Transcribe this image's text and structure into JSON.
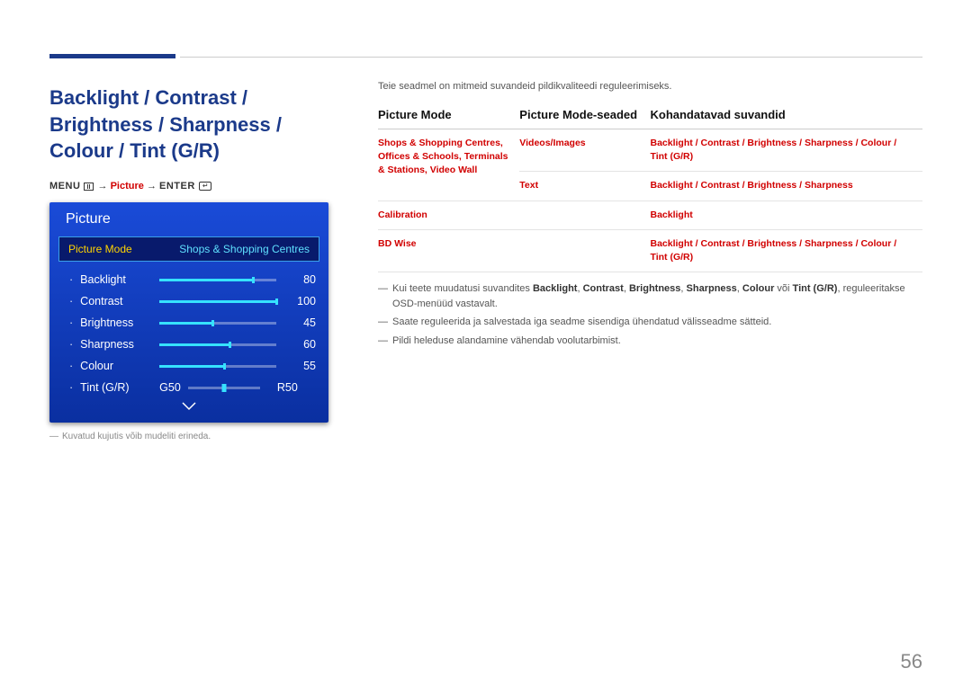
{
  "title": "Backlight / Contrast / Brightness / Sharpness / Colour / Tint (G/R)",
  "menupath": {
    "menu": "MENU",
    "picture": "Picture",
    "enter": "ENTER",
    "arrow": "→"
  },
  "osd": {
    "header": "Picture",
    "selected_label": "Picture Mode",
    "selected_value": "Shops & Shopping Centres",
    "rows": [
      {
        "label": "Backlight",
        "value": 80,
        "pct": 80
      },
      {
        "label": "Contrast",
        "value": 100,
        "pct": 100
      },
      {
        "label": "Brightness",
        "value": 45,
        "pct": 45
      },
      {
        "label": "Sharpness",
        "value": 60,
        "pct": 60
      },
      {
        "label": "Colour",
        "value": 55,
        "pct": 55
      }
    ],
    "tint": {
      "label": "Tint (G/R)",
      "g": "G50",
      "r": "R50"
    }
  },
  "footnote_small": "Kuvatud kujutis võib mudeliti erineda.",
  "intro": "Teie seadmel on mitmeid suvandeid pildikvaliteedi reguleerimiseks.",
  "table": {
    "headers": [
      "Picture Mode",
      "Picture Mode-seaded",
      "Kohandatavad suvandid"
    ],
    "rows": [
      {
        "c1": "Shops & Shopping Centres, Offices & Schools, Terminals & Stations, Video Wall",
        "c2": "Videos/Images",
        "c3": "Backlight / Contrast / Brightness / Sharpness / Colour / Tint (G/R)"
      },
      {
        "c1": "",
        "c2": "Text",
        "c3": "Backlight / Contrast / Brightness / Sharpness"
      },
      {
        "c1": "Calibration",
        "c2": "",
        "c3": "Backlight"
      },
      {
        "c1": "BD Wise",
        "c2": "",
        "c3": "Backlight / Contrast / Brightness / Sharpness / Colour / Tint (G/R)"
      }
    ]
  },
  "notes": {
    "n1_a": "Kui teete muudatusi suvandites ",
    "n1_b1": "Backlight",
    "n1_b2": "Contrast",
    "n1_b3": "Brightness",
    "n1_b4": "Sharpness",
    "n1_b5": "Colour",
    "n1_voi": " või ",
    "n1_b6": "Tint (G/R)",
    "n1_c": ", reguleeritakse OSD-menüüd vastavalt.",
    "n2": "Saate reguleerida ja salvestada iga seadme sisendiga ühendatud välisseadme sätteid.",
    "n3": "Pildi heleduse alandamine vähendab voolutarbimist."
  },
  "page_number": "56"
}
